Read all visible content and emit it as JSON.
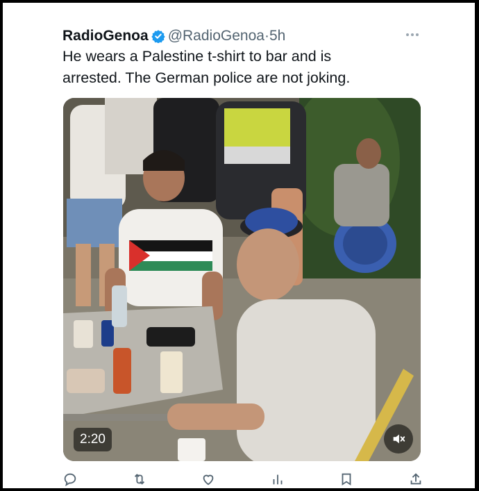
{
  "tweet": {
    "display_name": "RadioGenoa",
    "handle": "@RadioGenoa",
    "separator": "·",
    "time": "5h",
    "text": "He wears a Palestine t-shirt to bar and is\narrested. The German police are not joking."
  },
  "video": {
    "duration": "2:20"
  },
  "icons": {
    "verified": "verified-badge-icon",
    "more": "more-options-icon",
    "mute": "volume-muted-icon",
    "actions": [
      "reply-icon",
      "retweet-icon",
      "like-icon",
      "views-icon",
      "bookmark-icon",
      "share-icon"
    ]
  },
  "colors": {
    "verified_blue": "#1d9bf0",
    "text_primary": "#0f1419",
    "text_secondary": "#536471",
    "background": "#ffffff",
    "frame": "#000000"
  }
}
